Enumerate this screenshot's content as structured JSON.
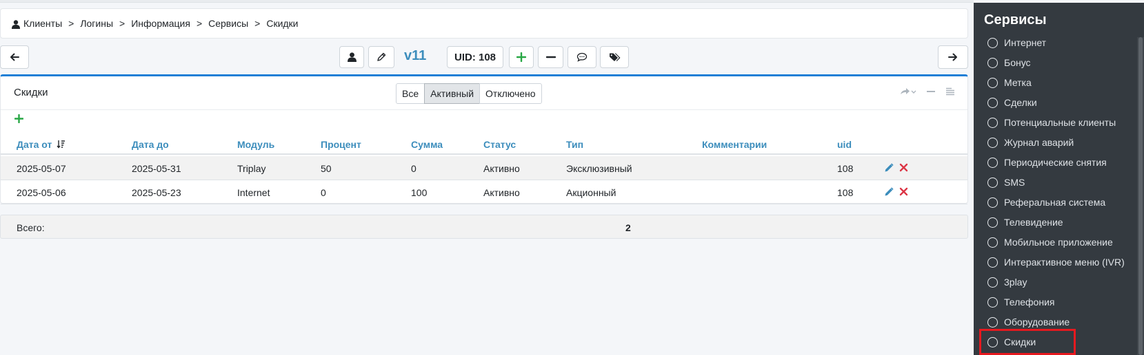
{
  "breadcrumb": [
    "Клиенты",
    "Логины",
    "Информация",
    "Сервисы",
    "Скидки"
  ],
  "breadcrumb_sep": ">",
  "toolbar": {
    "version": "v11",
    "uid_label": "UID: 108"
  },
  "card": {
    "title": "Скидки",
    "filters": [
      "Все",
      "Активный",
      "Отключено"
    ],
    "active_filter": "Активный"
  },
  "table": {
    "columns": [
      "Дата от",
      "Дата до",
      "Модуль",
      "Процент",
      "Сумма",
      "Статус",
      "Тип",
      "Комментарии",
      "uid"
    ],
    "rows": [
      [
        "2025-05-07",
        "2025-05-31",
        "Triplay",
        "50",
        "0",
        "Активно",
        "Эксклюзивный",
        "",
        "108"
      ],
      [
        "2025-05-06",
        "2025-05-23",
        "Internet",
        "0",
        "100",
        "Активно",
        "Акционный",
        "",
        "108"
      ]
    ]
  },
  "totals": {
    "label": "Всего:",
    "value": "2"
  },
  "sidebar": {
    "title": "Сервисы",
    "items": [
      "Интернет",
      "Бонус",
      "Метка",
      "Сделки",
      "Потенциальные клиенты",
      "Журнал аварий",
      "Периодические снятия",
      "SMS",
      "Реферальная система",
      "Телевидение",
      "Мобильное приложение",
      "Интерактивное меню (IVR)",
      "3play",
      "Телефония",
      "Оборудование",
      "Скидки"
    ],
    "selected": "Скидки"
  },
  "colors": {
    "accent": "#3c8dbc",
    "card_border": "#1e7fd6",
    "add": "#28a745",
    "delete": "#dc3545",
    "highlight": "#e6191f",
    "sidebar_bg": "#343a40"
  },
  "icons": [
    "user-icon",
    "arrow-left-icon",
    "pencil-icon",
    "plus-icon",
    "minus-icon",
    "comment-icon",
    "tags-icon",
    "arrow-right-icon",
    "share-icon",
    "collapse-icon",
    "list-icon",
    "sort-icon",
    "edit-icon",
    "delete-icon"
  ]
}
